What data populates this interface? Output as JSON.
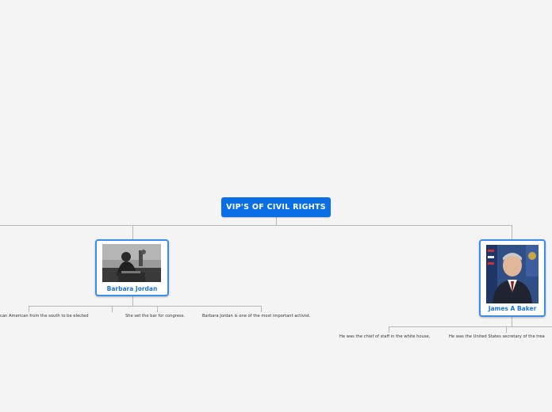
{
  "colors": {
    "root_fill": "#0a6fe6",
    "node_border": "#3a8de8",
    "name_text": "#1a73d9",
    "connector": "#b8b8b8",
    "background": "#f4f4f4"
  },
  "root": {
    "label": "VIP'S OF CIVIL RIGHTS"
  },
  "nodes": [
    {
      "name": "Barbara Jordan",
      "icon": "barbara-jordan-photo",
      "facts": [
        "can American from the south to be elected",
        "She set the bar for congress.",
        "Barbara Jordan is one of the most important activist."
      ]
    },
    {
      "name": "James A Baker",
      "icon": "james-baker-photo",
      "facts": [
        "He was the chief of staff in the white house,",
        "He was the United States secretary of the trea"
      ]
    }
  ]
}
